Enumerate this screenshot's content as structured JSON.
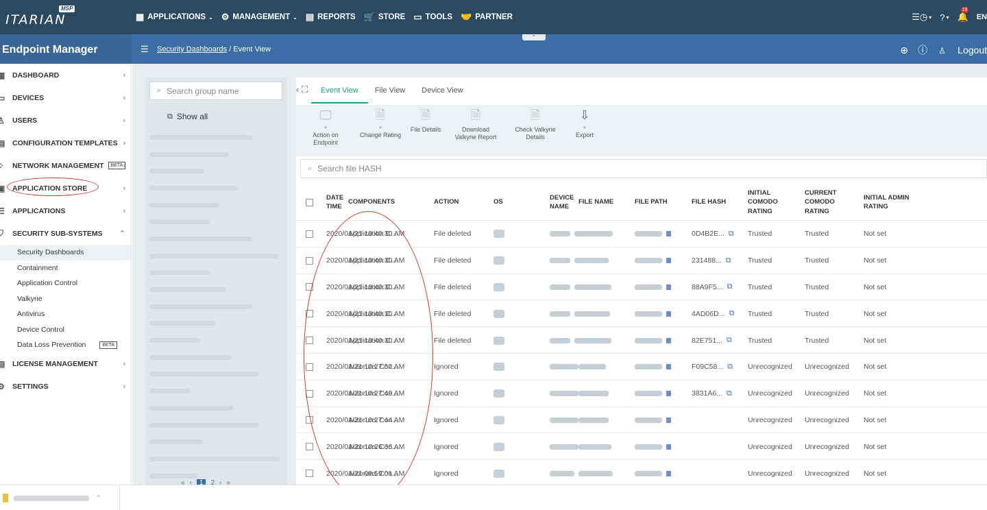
{
  "topnav": {
    "logo_text": "ITARIAN",
    "logo_badge": "MSP",
    "menu": [
      {
        "icon": "grid-icon",
        "glyph": "▦",
        "label": "APPLICATIONS",
        "caret": true
      },
      {
        "icon": "gears-icon",
        "glyph": "⚙",
        "label": "MANAGEMENT",
        "caret": true
      },
      {
        "icon": "report-icon",
        "glyph": "▤",
        "label": "REPORTS",
        "caret": false
      },
      {
        "icon": "cart-icon",
        "glyph": "🛒",
        "label": "STORE",
        "caret": false
      },
      {
        "icon": "toolbox-icon",
        "glyph": "▭",
        "label": "TOOLS",
        "caret": false
      },
      {
        "icon": "handshake-icon",
        "glyph": "🤝",
        "label": "PARTNER",
        "caret": false
      }
    ],
    "notification_count": "19",
    "lang": "EN"
  },
  "subheader": {
    "app_title": "Endpoint Manager",
    "breadcrumb_link": "Security Dashboards",
    "breadcrumb_sep": "/",
    "breadcrumb_current": "Event View",
    "logout_label": "Logout"
  },
  "sidebar": {
    "items_top": [
      {
        "label": "DASHBOARD",
        "icon": "dashboard-icon",
        "glyph": "▦"
      },
      {
        "label": "DEVICES",
        "icon": "devices-icon",
        "glyph": "▭"
      },
      {
        "label": "USERS",
        "icon": "user-icon",
        "glyph": "♙"
      },
      {
        "label": "CONFIGURATION TEMPLATES",
        "icon": "template-icon",
        "glyph": "▤"
      },
      {
        "label": "NETWORK MANAGEMENT",
        "icon": "network-icon",
        "glyph": "⁘",
        "beta": "BETA"
      },
      {
        "label": "APPLICATION STORE",
        "icon": "store-icon",
        "glyph": "▣"
      },
      {
        "label": "APPLICATIONS",
        "icon": "apps-icon",
        "glyph": "☰"
      },
      {
        "label": "SECURITY SUB-SYSTEMS",
        "icon": "shield-icon",
        "glyph": "⛉",
        "expanded": true
      }
    ],
    "sub_items": [
      {
        "label": "Security Dashboards",
        "active": true
      },
      {
        "label": "Containment"
      },
      {
        "label": "Application Control"
      },
      {
        "label": "Valkyrie"
      },
      {
        "label": "Antivirus"
      },
      {
        "label": "Device Control"
      },
      {
        "label": "Data Loss Prevention",
        "beta": "BETA"
      }
    ],
    "items_bottom": [
      {
        "label": "LICENSE MANAGEMENT",
        "icon": "license-icon",
        "glyph": "▤"
      },
      {
        "label": "SETTINGS",
        "icon": "settings-icon",
        "glyph": "⚙"
      }
    ]
  },
  "groups": {
    "search_placeholder": "Search group name",
    "show_all": "Show all",
    "pager": [
      "«",
      "‹",
      "1",
      "2",
      "›",
      "»"
    ]
  },
  "tabs": [
    "Event View",
    "File View",
    "Device View"
  ],
  "toolbar": [
    {
      "label": "Action on Endpoint",
      "icon": "monitor-action-icon",
      "glyph": "🖵",
      "dropdown": true,
      "enabled": false
    },
    {
      "label": "Change Rating",
      "icon": "rating-icon",
      "glyph": "🗎",
      "dropdown": true,
      "enabled": false
    },
    {
      "label": "File Details",
      "icon": "file-details-icon",
      "glyph": "🗎",
      "dropdown": false,
      "enabled": false
    },
    {
      "label": "Download Valkyrie Report",
      "icon": "download-report-icon",
      "glyph": "🗎",
      "dropdown": false,
      "enabled": false
    },
    {
      "label": "Check Valkyrie Details",
      "icon": "check-details-icon",
      "glyph": "🗎",
      "dropdown": false,
      "enabled": false
    },
    {
      "label": "Export",
      "icon": "export-icon",
      "glyph": "⇩",
      "dropdown": true,
      "enabled": true
    }
  ],
  "hash_search_placeholder": "Search file HASH",
  "table": {
    "headers": [
      "DATE TIME",
      "COMPONENTS",
      "ACTION",
      "OS",
      "DEVICE NAME",
      "FILE NAME",
      "FILE PATH",
      "FILE HASH",
      "INITIAL COMODO RATING",
      "CURRENT COMODO RATING",
      "INITIAL ADMIN RATING"
    ],
    "rows": [
      {
        "date": "2020/01/21 10:40:30 AM",
        "component": "Application C...",
        "action": "File deleted",
        "hash": "0D4B2E...",
        "initial": "Trusted",
        "current": "Trusted",
        "admin": "Not set"
      },
      {
        "date": "2020/01/21 10:40:30 AM",
        "component": "Application C...",
        "action": "File deleted",
        "hash": "231488...",
        "initial": "Trusted",
        "current": "Trusted",
        "admin": "Not set"
      },
      {
        "date": "2020/01/21 10:40:30 AM",
        "component": "Application C...",
        "action": "File deleted",
        "hash": "88A9F5...",
        "initial": "Trusted",
        "current": "Trusted",
        "admin": "Not set"
      },
      {
        "date": "2020/01/21 10:40:30 AM",
        "component": "Application C...",
        "action": "File deleted",
        "hash": "4AD06D...",
        "initial": "Trusted",
        "current": "Trusted",
        "admin": "Not set"
      },
      {
        "date": "2020/01/21 10:40:30 AM",
        "component": "Application C...",
        "action": "File deleted",
        "hash": "82E751...",
        "initial": "Trusted",
        "current": "Trusted",
        "admin": "Not set"
      },
      {
        "date": "2020/01/21 10:27:52 AM",
        "component": "Autoruns Con...",
        "action": "Ignored",
        "hash": "F09C58...",
        "initial": "Unrecognized",
        "current": "Unrecognized",
        "admin": "Not set"
      },
      {
        "date": "2020/01/21 10:27:49 AM",
        "component": "Autoruns Con...",
        "action": "Ignored",
        "hash": "3831A6...",
        "initial": "Unrecognized",
        "current": "Unrecognized",
        "admin": "Not set"
      },
      {
        "date": "2020/01/21 10:27:44 AM",
        "component": "Autoruns Con...",
        "action": "Ignored",
        "hash": "",
        "initial": "Unrecognized",
        "current": "Unrecognized",
        "admin": "Not set"
      },
      {
        "date": "2020/01/21 10:26:36 AM",
        "component": "Autoruns Con...",
        "action": "Ignored",
        "hash": "",
        "initial": "Unrecognized",
        "current": "Unrecognized",
        "admin": "Not set"
      },
      {
        "date": "2020/01/21 09:59:01 AM",
        "component": "Autoruns Con...",
        "action": "Ignored",
        "hash": "",
        "initial": "Unrecognized",
        "current": "Unrecognized",
        "admin": "Not set"
      }
    ]
  },
  "colors": {
    "nav_bg": "#2b4a62",
    "subheader_bg": "#3a6ea5",
    "tab_active": "#1d9f80",
    "annotation_ring": "#d23a2e"
  }
}
